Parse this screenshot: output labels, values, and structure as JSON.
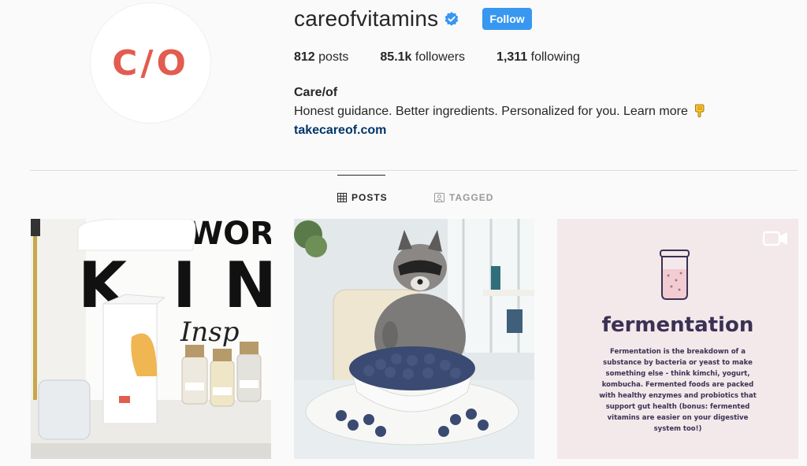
{
  "profile": {
    "avatar_text": "C/O",
    "username": "careofvitamins",
    "verified": true,
    "follow_label": "Follow",
    "stats": {
      "posts_count": "812",
      "posts_label": "posts",
      "followers_count": "85.1k",
      "followers_label": "followers",
      "following_count": "1,311",
      "following_label": "following"
    },
    "bio": {
      "name": "Care/of",
      "text": "Honest guidance. Better ingredients. Personalized for you. Learn more",
      "emoji": "pointing-down-emoji",
      "link": "takecareof.com"
    }
  },
  "tabs": [
    {
      "label": "POSTS",
      "icon": "grid-icon",
      "active": true
    },
    {
      "label": "TAGGED",
      "icon": "tag-icon",
      "active": false
    }
  ],
  "posts": [
    {
      "kind": "photo",
      "subject": "vitamin-box-desk-photo",
      "sign_text": "WOR KIN Insp"
    },
    {
      "kind": "photo",
      "subject": "raccoon-blueberries-photo"
    },
    {
      "kind": "video",
      "icon": "video-camera-icon",
      "title": "fermentation",
      "body": "Fermentation is the breakdown of a substance by bacteria or yeast to make something else - think kimchi, yogurt, kombucha. Fermented foods are packed with healthy enzymes and probiotics that support gut health (bonus: fermented vitamins are easier on your digestive system too!)"
    }
  ],
  "colors": {
    "brand": "#e25c4f",
    "follow_button": "#3897f0",
    "verified_badge": "#3897f0",
    "link": "#003569",
    "text": "#262626",
    "muted": "#999999",
    "fermentation_text": "#3b3154"
  }
}
